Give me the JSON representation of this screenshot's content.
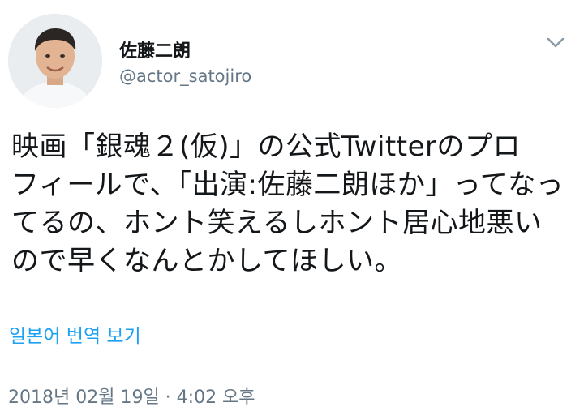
{
  "author": {
    "display_name": "佐藤二朗",
    "handle": "@actor_satojiro"
  },
  "tweet": {
    "lines": [
      "映画「銀魂２(仮)」の公式Twitterのプロ",
      "フィールで、「出演:佐藤二朗ほか」ってなっ",
      "てるの、ホント笑えるしホント居心地悪い",
      "ので早くなんとかしてほしい。"
    ],
    "translate_label": "일본어 번역 보기",
    "timestamp": "2018년 02월 19일 · 4:02 오후"
  },
  "icons": {
    "menu": "chevron-down-icon",
    "avatar": "profile-photo"
  },
  "colors": {
    "link": "#1da1f2",
    "secondary_text": "#657786",
    "primary_text": "#14171a"
  }
}
